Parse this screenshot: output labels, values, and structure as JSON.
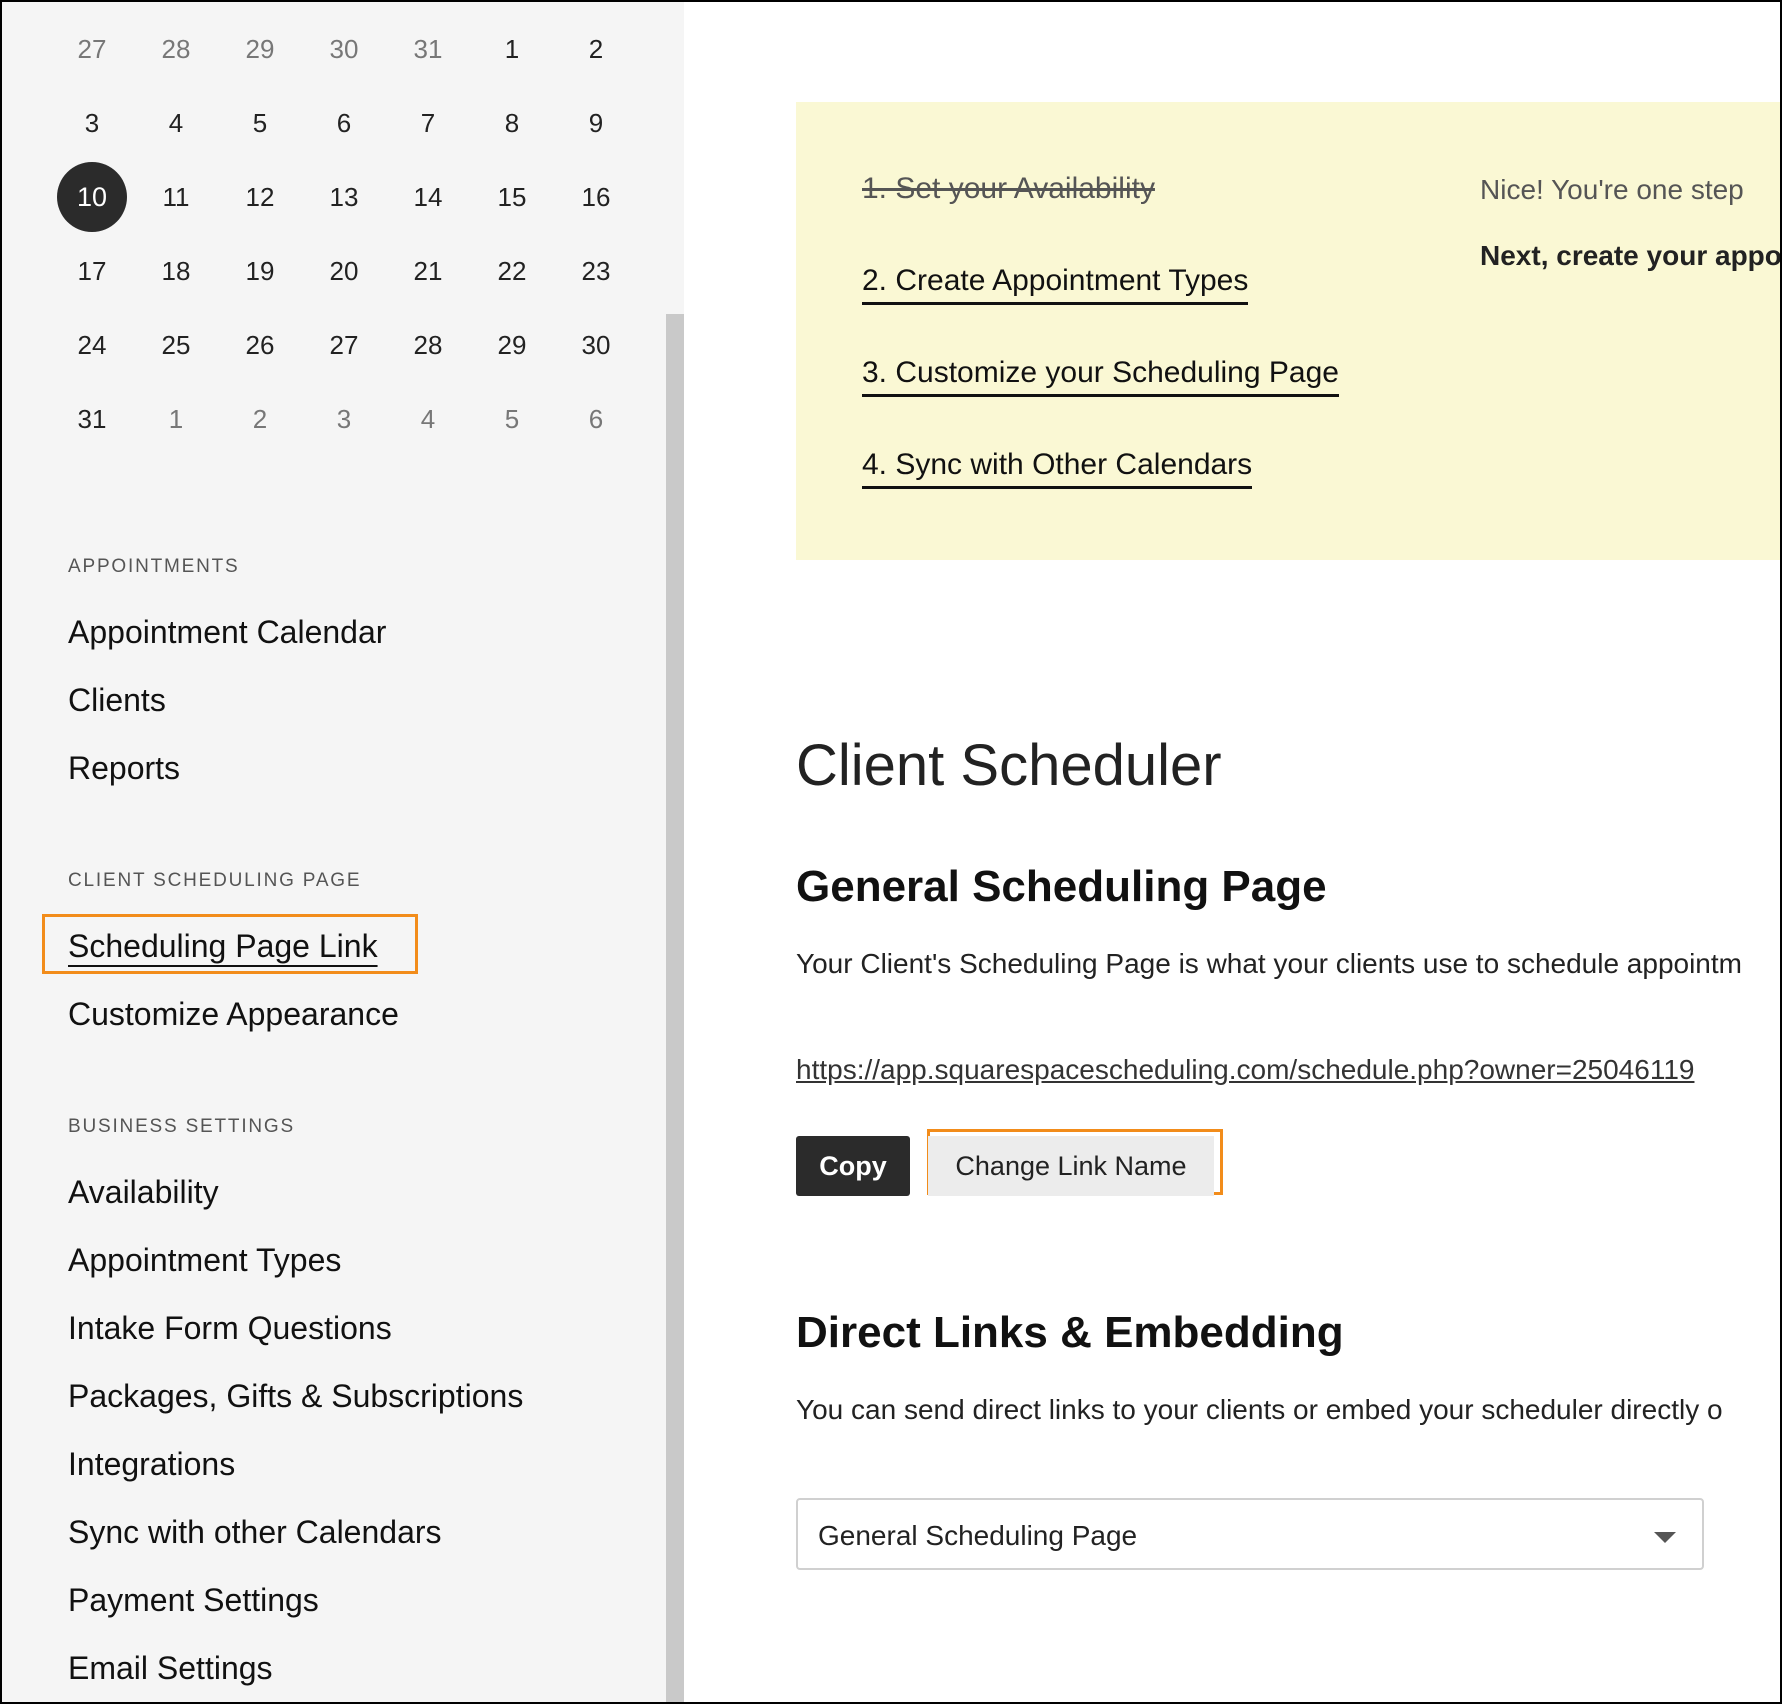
{
  "calendar": {
    "weeks": [
      [
        {
          "d": "27",
          "muted": true
        },
        {
          "d": "28",
          "muted": true
        },
        {
          "d": "29",
          "muted": true
        },
        {
          "d": "30",
          "muted": true
        },
        {
          "d": "31",
          "muted": true
        },
        {
          "d": "1"
        },
        {
          "d": "2"
        }
      ],
      [
        {
          "d": "3"
        },
        {
          "d": "4"
        },
        {
          "d": "5"
        },
        {
          "d": "6"
        },
        {
          "d": "7"
        },
        {
          "d": "8"
        },
        {
          "d": "9"
        }
      ],
      [
        {
          "d": "10",
          "selected": true
        },
        {
          "d": "11"
        },
        {
          "d": "12"
        },
        {
          "d": "13"
        },
        {
          "d": "14"
        },
        {
          "d": "15"
        },
        {
          "d": "16"
        }
      ],
      [
        {
          "d": "17"
        },
        {
          "d": "18"
        },
        {
          "d": "19"
        },
        {
          "d": "20"
        },
        {
          "d": "21"
        },
        {
          "d": "22"
        },
        {
          "d": "23"
        }
      ],
      [
        {
          "d": "24"
        },
        {
          "d": "25"
        },
        {
          "d": "26"
        },
        {
          "d": "27"
        },
        {
          "d": "28"
        },
        {
          "d": "29"
        },
        {
          "d": "30"
        }
      ],
      [
        {
          "d": "31"
        },
        {
          "d": "1",
          "muted": true
        },
        {
          "d": "2",
          "muted": true
        },
        {
          "d": "3",
          "muted": true
        },
        {
          "d": "4",
          "muted": true
        },
        {
          "d": "5",
          "muted": true
        },
        {
          "d": "6",
          "muted": true
        }
      ]
    ]
  },
  "sidebar": {
    "appointments_heading": "APPOINTMENTS",
    "appointments": [
      "Appointment Calendar",
      "Clients",
      "Reports"
    ],
    "client_page_heading": "CLIENT SCHEDULING PAGE",
    "client_page": [
      "Scheduling Page Link",
      "Customize Appearance"
    ],
    "business_heading": "BUSINESS SETTINGS",
    "business": [
      "Availability",
      "Appointment Types",
      "Intake Form Questions",
      "Packages, Gifts & Subscriptions",
      "Integrations",
      "Sync with other Calendars",
      "Payment Settings",
      "Email Settings"
    ]
  },
  "setup": {
    "steps": [
      "1. Set your Availability",
      "2. Create Appointment Types",
      "3. Customize your Scheduling Page",
      "4. Sync with Other Calendars"
    ],
    "message": "Nice! You're one step",
    "next": "Next, create your appo"
  },
  "main": {
    "title": "Client Scheduler",
    "general_heading": "General Scheduling Page",
    "general_desc": "Your Client's Scheduling Page is what your clients use to schedule appointm",
    "link": "https://app.squarespacescheduling.com/schedule.php?owner=25046119",
    "copy_label": "Copy",
    "change_label": "Change Link Name",
    "direct_heading": "Direct Links & Embedding",
    "direct_desc": "You can send direct links to your clients or embed your scheduler directly o",
    "select_value": "General Scheduling Page"
  },
  "colors": {
    "highlight": "#f28c1a",
    "card": "#faf8d4",
    "dark": "#2b2b2b"
  }
}
